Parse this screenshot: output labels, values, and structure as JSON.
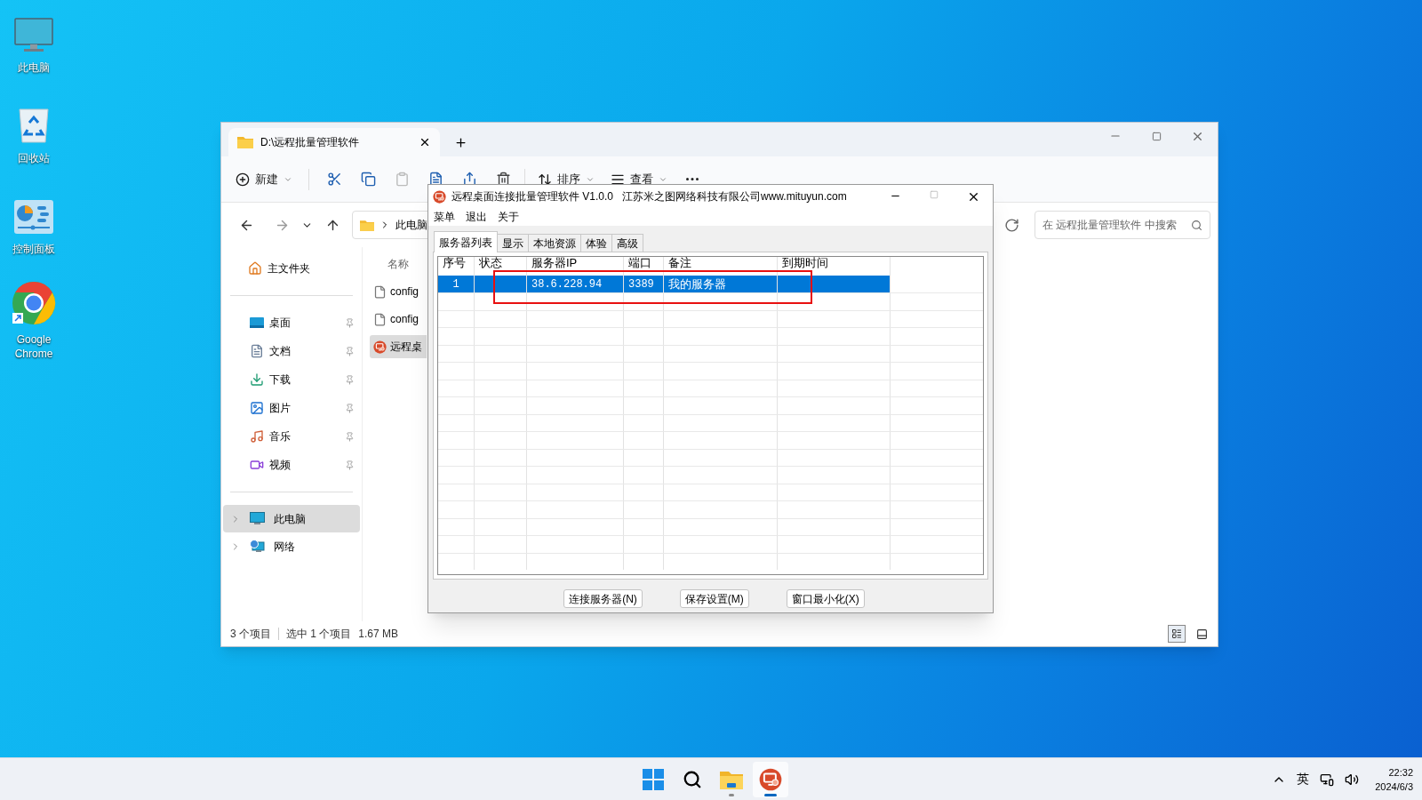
{
  "desktop": {
    "icons": [
      {
        "kind": "computer",
        "label": "此电脑"
      },
      {
        "kind": "recycle",
        "label": "回收站"
      },
      {
        "kind": "control",
        "label": "控制面板"
      },
      {
        "kind": "chrome",
        "label": "Google Chrome"
      }
    ]
  },
  "explorer": {
    "tab_title": "D:\\远程批量管理软件",
    "toolbar": [
      {
        "kind": "new",
        "label": "新建"
      },
      {
        "kind": "sort",
        "label": "排序"
      },
      {
        "kind": "view",
        "label": "查看"
      }
    ],
    "breadcrumb": "此电脑",
    "search": {
      "placeholder": "在 远程批量管理软件 中搜索"
    },
    "home": "主文件夹",
    "quick_access": [
      {
        "kind": "desktop",
        "label": "桌面",
        "pinned": true
      },
      {
        "kind": "docs",
        "label": "文档",
        "pinned": true
      },
      {
        "kind": "download",
        "label": "下载",
        "pinned": true
      },
      {
        "kind": "pictures",
        "label": "图片",
        "pinned": true
      },
      {
        "kind": "music",
        "label": "音乐",
        "pinned": true
      },
      {
        "kind": "video",
        "label": "视频",
        "pinned": true
      }
    ],
    "tree": [
      {
        "kind": "computer",
        "label": "此电脑",
        "selected": true,
        "expanded": false
      },
      {
        "kind": "network",
        "label": "网络",
        "selected": false,
        "expanded": false
      }
    ],
    "column": "名称",
    "files": [
      {
        "kind": "file",
        "name": "config",
        "selected": false
      },
      {
        "kind": "file",
        "name": "config",
        "selected": false
      },
      {
        "kind": "app",
        "name": "远程桌",
        "selected": true
      }
    ],
    "status": [
      "3 个项目",
      "选中 1 个项目",
      "1.67 MB"
    ]
  },
  "app": {
    "title": "远程桌面连接批量管理软件 V1.0.0   江苏米之图网络科技有限公司www.mituyun.com",
    "menu": [
      "菜单",
      "退出",
      "关于"
    ],
    "tabs": [
      {
        "label": "服务器列表",
        "selected": true
      },
      {
        "label": "显示",
        "selected": false
      },
      {
        "label": "本地资源",
        "selected": false
      },
      {
        "label": "体验",
        "selected": false
      },
      {
        "label": "高级",
        "selected": false
      }
    ],
    "columns": [
      "序号",
      "状态",
      "服务器IP",
      "端口",
      "备注",
      "到期时间"
    ],
    "rows": [
      {
        "cells": [
          "1",
          "",
          "38.6.228.94",
          "3389",
          "我的服务器",
          ""
        ],
        "selected": true
      }
    ],
    "buttons": [
      "连接服务器(N)",
      "保存设置(M)",
      "窗口最小化(X)"
    ]
  },
  "taskbar": {
    "apps": [
      {
        "kind": "start",
        "running": false,
        "active": false
      },
      {
        "kind": "search",
        "running": false,
        "active": false
      },
      {
        "kind": "folder",
        "running": true,
        "active": false
      },
      {
        "kind": "remote",
        "running": true,
        "active": true
      }
    ],
    "tray": {
      "language": "英",
      "time": "22:32",
      "date": "2024/6/3"
    }
  }
}
